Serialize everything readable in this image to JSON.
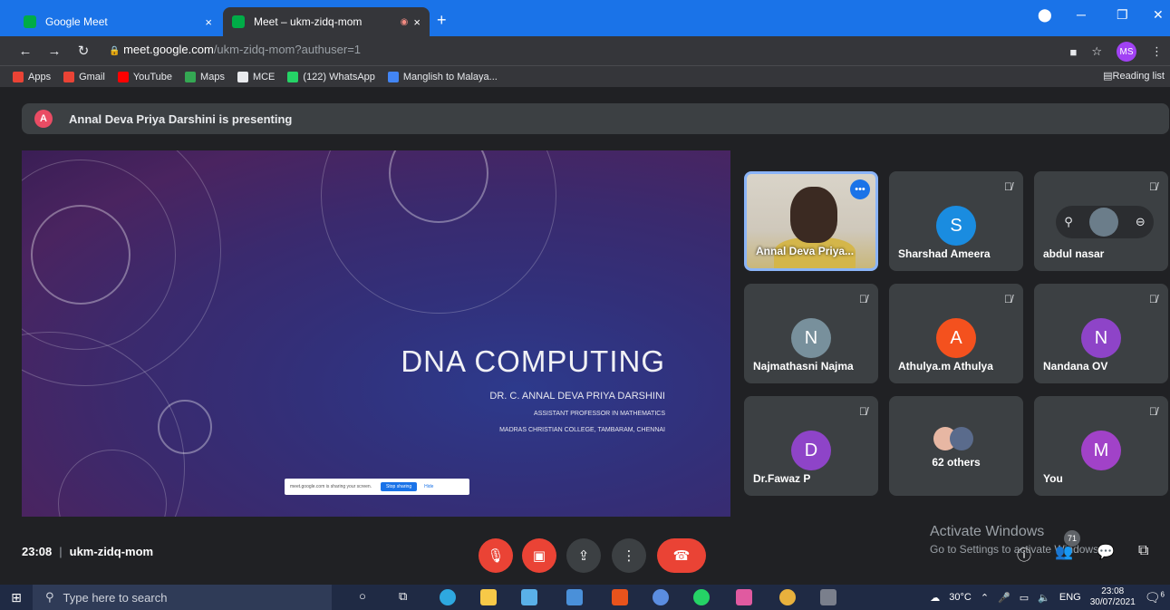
{
  "browser": {
    "tabs": [
      {
        "label": "Google Meet",
        "close": "×"
      },
      {
        "label": "Meet – ukm-zidq-mom",
        "close": "×",
        "rec": "◉"
      }
    ],
    "new_tab": "+",
    "window_controls": {
      "minimize": "─",
      "maximize": "❐",
      "close": "✕"
    },
    "url": {
      "lock": "🔒",
      "host": "meet.google.com",
      "path": "/ukm-zidq-mom?authuser=1"
    },
    "profile": "MS",
    "bookmarks": [
      {
        "label": "Apps",
        "color": "#ea4335"
      },
      {
        "label": "Gmail",
        "color": "#ea4335"
      },
      {
        "label": "YouTube",
        "color": "#ff0000"
      },
      {
        "label": "Maps",
        "color": "#34a853"
      },
      {
        "label": "MCE",
        "color": "#e8eaed"
      },
      {
        "label": "(122) WhatsApp",
        "color": "#25d366"
      },
      {
        "label": "Manglish to Malaya...",
        "color": "#4285f4"
      }
    ],
    "reading_list": "Reading list"
  },
  "banner": {
    "initial": "A",
    "text": "Annal Deva Priya Darshini is presenting"
  },
  "slide": {
    "title": "DNA COMPUTING",
    "line1": "DR. C. ANNAL DEVA PRIYA DARSHINI",
    "line2": "ASSISTANT PROFESSOR IN MATHEMATICS",
    "line3": "MADRAS CHRISTIAN COLLEGE, TAMBARAM, CHENNAI",
    "sharebar": {
      "text": "meet.google.com is sharing your screen.",
      "stop": "Stop sharing",
      "hide": "Hide"
    }
  },
  "participants": [
    {
      "name": "Annal Deva Priya...",
      "type": "video"
    },
    {
      "name": "Sharshad Ameera",
      "initial": "S",
      "color": "#1a8ce0"
    },
    {
      "name": "abdul nasar",
      "type": "pinned"
    },
    {
      "name": "Najmathasni Najma",
      "initial": "N",
      "color": "#78909c"
    },
    {
      "name": "Athulya.m Athulya",
      "initial": "A",
      "color": "#f4511e"
    },
    {
      "name": "Nandana OV",
      "initial": "N",
      "color": "#8e44c8"
    },
    {
      "name": "Dr.Fawaz P",
      "initial": "D",
      "color": "#8e44c8"
    },
    {
      "name": "62 others",
      "type": "others"
    },
    {
      "name": "You",
      "initial": "M",
      "color": "#a142c8"
    }
  ],
  "meeting": {
    "time": "23:08",
    "separator": "|",
    "code": "ukm-zidq-mom"
  },
  "controls": {
    "mic": "🎙",
    "cam": "📷",
    "present": "⬆",
    "more": "⋮",
    "end": "☎"
  },
  "activate": {
    "title": "Activate Windows",
    "sub": "Go to Settings to activate Windows."
  },
  "people_count": "71",
  "taskbar": {
    "search_placeholder": "Type here to search",
    "weather": "30°C",
    "lang": "ENG",
    "time": "23:08",
    "date": "30/07/2021",
    "notif_count": "6"
  }
}
